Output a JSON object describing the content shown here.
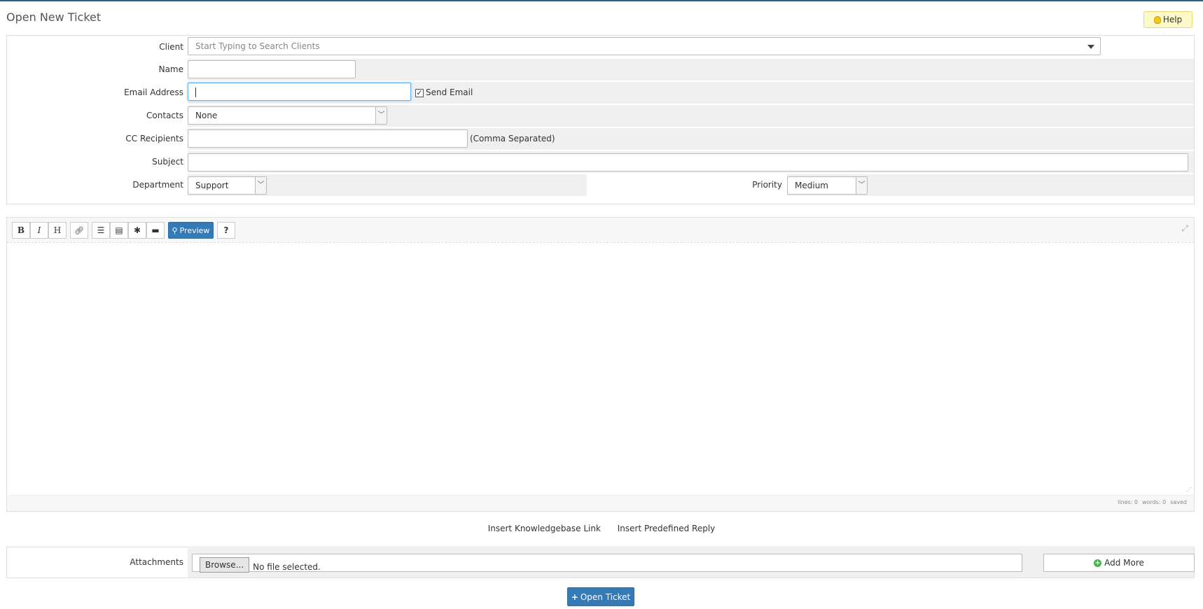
{
  "page": {
    "title": "Open New Ticket"
  },
  "help": {
    "label": "Help"
  },
  "form": {
    "client": {
      "label": "Client",
      "placeholder": "Start Typing to Search Clients"
    },
    "name": {
      "label": "Name",
      "value": ""
    },
    "email": {
      "label": "Email Address",
      "value": "",
      "send_email_label": "Send Email",
      "send_email_checked": true
    },
    "contacts": {
      "label": "Contacts",
      "selected": "None"
    },
    "cc": {
      "label": "CC Recipients",
      "value": "",
      "hint": "(Comma Separated)"
    },
    "subject": {
      "label": "Subject",
      "value": ""
    },
    "department": {
      "label": "Department",
      "selected": "Support"
    },
    "priority": {
      "label": "Priority",
      "selected": "Medium"
    }
  },
  "editor": {
    "toolbar": {
      "bold": "B",
      "italic": "I",
      "heading": "H",
      "preview_label": "Preview"
    },
    "status": {
      "lines": "lines: 0",
      "words": "words: 0",
      "saved": "saved"
    }
  },
  "insert_links": {
    "knowledgebase": "Insert Knowledgebase Link",
    "predefined": "Insert Predefined Reply"
  },
  "attachments": {
    "label": "Attachments",
    "browse_label": "Browse...",
    "no_file": "No file selected.",
    "add_more_label": "Add More"
  },
  "submit": {
    "label": "Open Ticket"
  },
  "colors": {
    "primary": "#337ab7",
    "help_bg": "#fdf9c8",
    "field_bg": "#efefef",
    "top_bar": "#2b5f94"
  }
}
